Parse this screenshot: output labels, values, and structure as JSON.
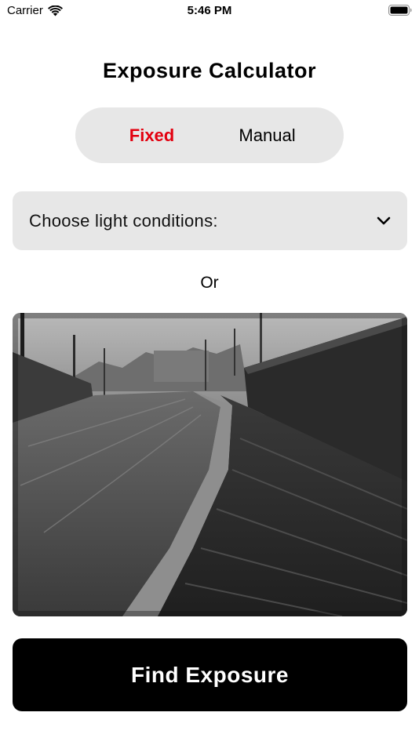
{
  "status_bar": {
    "carrier": "Carrier",
    "time": "5:46 PM"
  },
  "title": "Exposure Calculator",
  "mode_toggle": {
    "options": [
      "Fixed",
      "Manual"
    ],
    "selected": "Fixed"
  },
  "light_conditions": {
    "label": "Choose light conditions:"
  },
  "separator_text": "Or",
  "photo": {
    "description_icon": "photo-preview"
  },
  "action": {
    "find_label": "Find Exposure"
  },
  "colors": {
    "accent": "#e3000f",
    "control_bg": "#e7e7e7",
    "button_bg": "#000000"
  }
}
